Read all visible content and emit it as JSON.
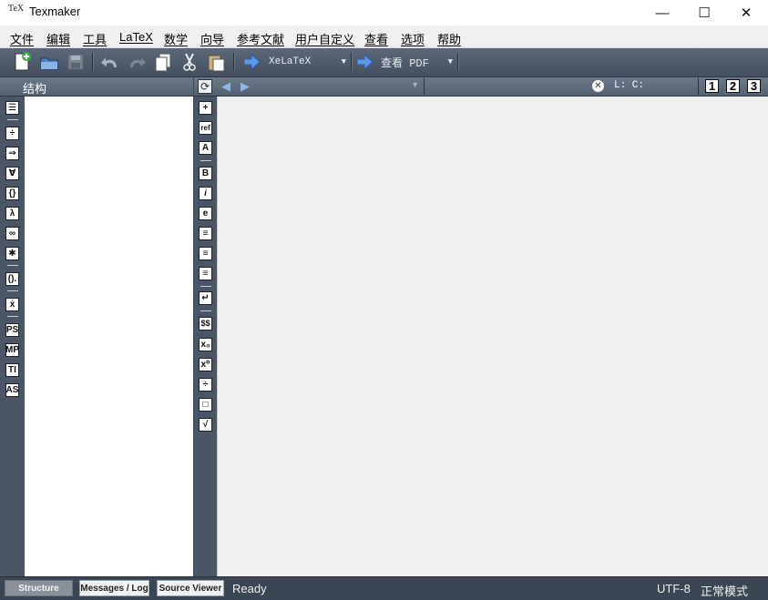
{
  "window": {
    "title": "Texmaker",
    "icon_text": "TeX"
  },
  "controls": {
    "minimize": "—",
    "maximize": "☐",
    "close": "✕"
  },
  "menu": [
    "文件",
    "编辑",
    "工具",
    "LaTeX",
    "数学",
    "向导",
    "参考文献",
    "用户自定义",
    "查看",
    "选项",
    "帮助"
  ],
  "toolbar": {
    "compile_combo": "XeLaTeX",
    "view_combo": "查看 PDF"
  },
  "structure": {
    "title": "结构"
  },
  "editor_header": {
    "position_label": "L: C:",
    "view_buttons": [
      "1",
      "2",
      "3"
    ]
  },
  "structure_sidebar": [
    "☰",
    "÷",
    "⇒",
    "∀",
    "{}",
    "λ",
    "∞",
    "✱",
    "().",
    "ẋ",
    "PS",
    "MP",
    "TI",
    "AS"
  ],
  "editor_sidebar": [
    "+",
    "ref",
    "A",
    "B",
    "i",
    "e",
    "≡",
    "≡",
    "≡",
    "↵",
    "$$",
    "x₀",
    "x⁰",
    "÷",
    "□",
    "√"
  ],
  "statusbar": {
    "tabs": [
      "Structure",
      "Messages / Log",
      "Source Viewer"
    ],
    "status": "Ready",
    "encoding": "UTF-8",
    "mode": "正常模式"
  }
}
